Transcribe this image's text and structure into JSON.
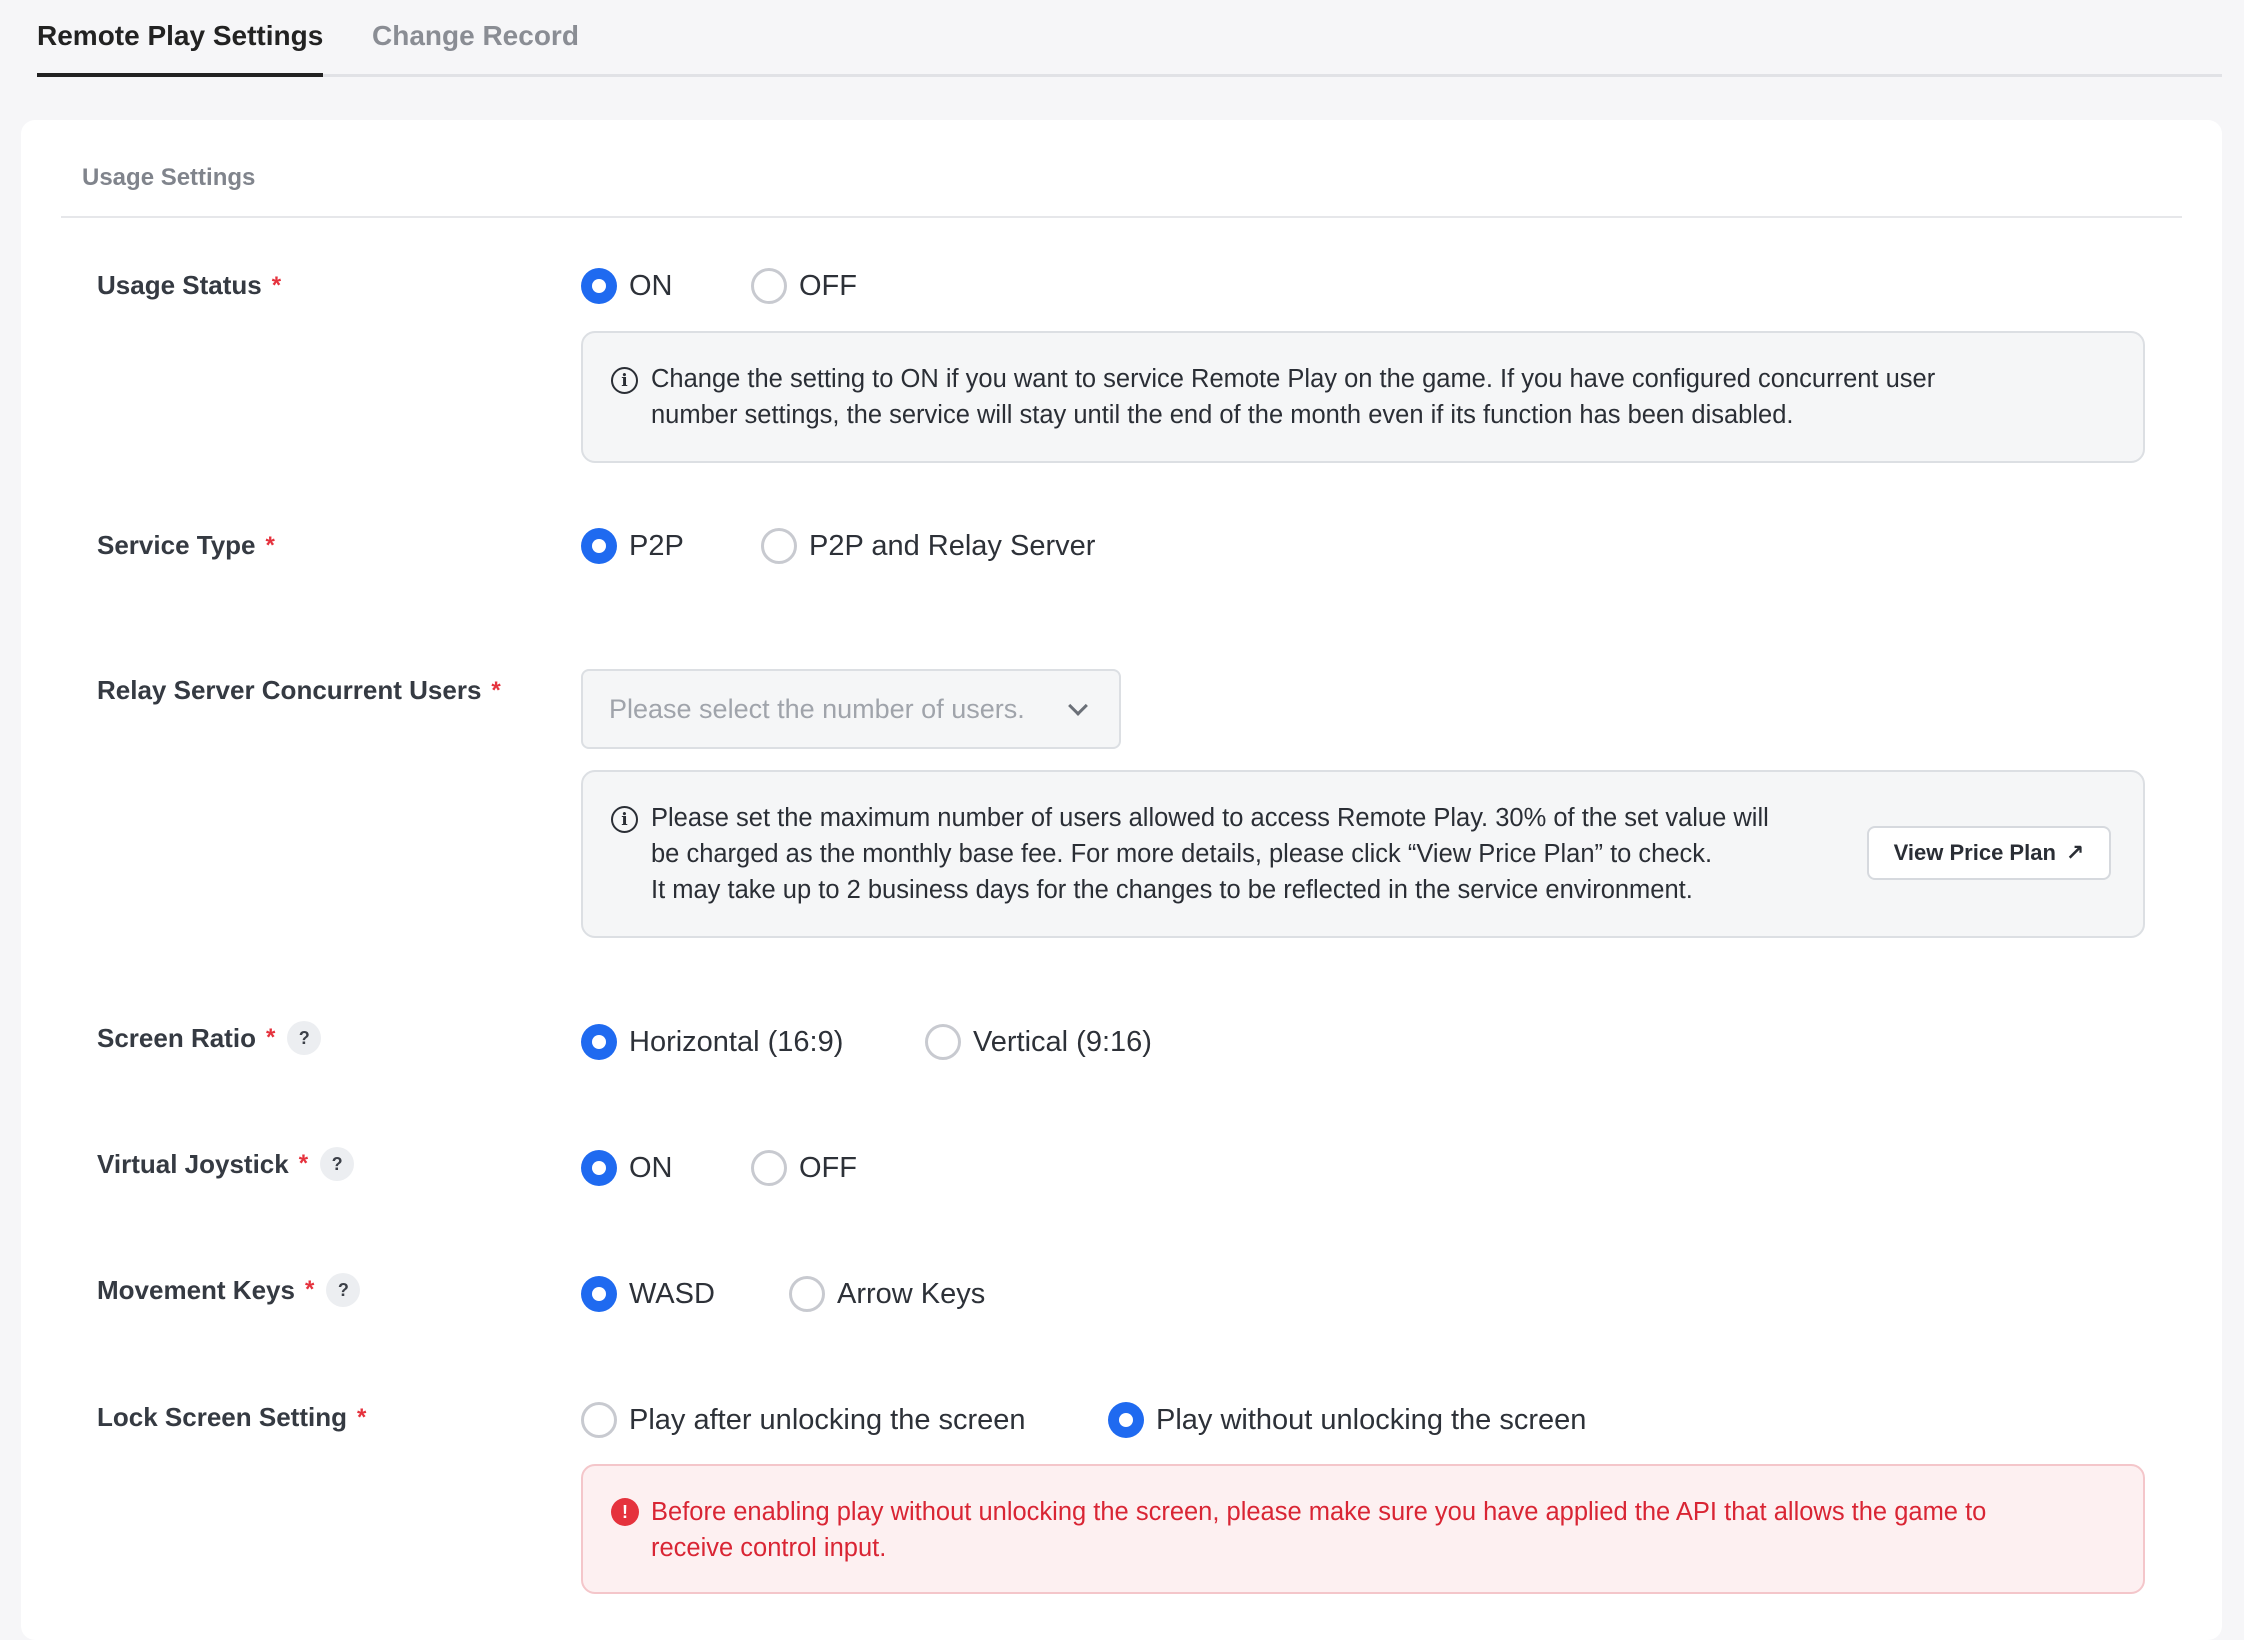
{
  "tabs": [
    {
      "label": "Remote Play Settings",
      "active": true
    },
    {
      "label": "Change Record",
      "active": false
    }
  ],
  "section_title": "Usage Settings",
  "fields": {
    "usage_status": {
      "label": "Usage Status",
      "required": "*",
      "options": [
        "ON",
        "OFF"
      ],
      "selected": "ON",
      "info_line1": "Change the setting to ON if you want to service Remote Play on the game. If you have configured concurrent user",
      "info_line2": "number settings, the service will stay until the end of the month even if its function has been disabled."
    },
    "service_type": {
      "label": "Service Type",
      "required": "*",
      "options": [
        "P2P",
        "P2P and Relay Server"
      ],
      "selected": "P2P"
    },
    "relay_users": {
      "label": "Relay Server Concurrent Users",
      "required": "*",
      "placeholder": "Please select the number of users.",
      "info_line1": "Please set the maximum number of users allowed to access Remote Play. 30% of the set value will",
      "info_line2": "be charged as the monthly base fee. For more details, please click “View Price Plan” to check.",
      "info_line3": "It may take up to 2 business days for the changes to be reflected in the service environment.",
      "price_button": "View Price Plan"
    },
    "screen_ratio": {
      "label": "Screen Ratio",
      "required": "*",
      "help": "?",
      "options": [
        "Horizontal (16:9)",
        "Vertical (9:16)"
      ],
      "selected": "Horizontal (16:9)"
    },
    "virtual_joystick": {
      "label": "Virtual Joystick",
      "required": "*",
      "help": "?",
      "options": [
        "ON",
        "OFF"
      ],
      "selected": "ON"
    },
    "movement_keys": {
      "label": "Movement Keys",
      "required": "*",
      "help": "?",
      "options": [
        "WASD",
        "Arrow Keys"
      ],
      "selected": "WASD"
    },
    "lock_screen": {
      "label": "Lock Screen Setting",
      "required": "*",
      "options": [
        "Play after unlocking the screen",
        "Play without unlocking the screen"
      ],
      "selected": "Play without unlocking the screen",
      "warn_line1": "Before enabling play without unlocking the screen, please make sure you have applied the API that allows the game to",
      "warn_line2": "receive control input."
    }
  },
  "icons": {
    "info": "info-circle-icon",
    "warning": "exclamation-circle-icon",
    "external": "arrow-up-right-icon",
    "dropdown": "chevron-down-icon"
  },
  "colors": {
    "accent": "#1f6af0",
    "required": "#e5323d",
    "warning_text": "#d92534",
    "warning_bg": "#fdf0f1"
  }
}
